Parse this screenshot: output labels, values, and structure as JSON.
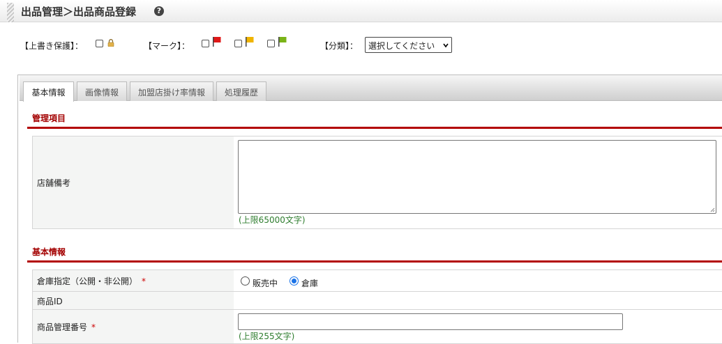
{
  "header": {
    "title": "出品管理＞出品商品登録",
    "help_icon": "question-circle-icon"
  },
  "options": {
    "overwrite_label": "【上書き保護】：",
    "mark_label": "【マーク】：",
    "category_label": "【分類】：",
    "category_selected": "選択してください",
    "flag_colors": [
      "#e01818",
      "#f0b400",
      "#7ab317"
    ]
  },
  "tabs": [
    {
      "label": "基本情報",
      "active": true
    },
    {
      "label": "画像情報",
      "active": false
    },
    {
      "label": "加盟店掛け率情報",
      "active": false
    },
    {
      "label": "処理履歴",
      "active": false
    }
  ],
  "sections": {
    "management": {
      "title": "管理項目",
      "store_note_label": "店舗備考",
      "store_note_hint": "(上限65000文字)"
    },
    "basic": {
      "title": "基本情報",
      "warehouse_label": "倉庫指定（公開・非公開）",
      "required_mark": "*",
      "radio_on_sale": "販売中",
      "radio_warehouse": "倉庫",
      "selected_radio": "倉庫",
      "product_id_label": "商品ID",
      "product_code_label": "商品管理番号",
      "product_code_hint": "(上限255文字)"
    }
  },
  "colors": {
    "accent": "#b30000",
    "hint": "#2e7d2e",
    "radio": "#1a73e8"
  }
}
